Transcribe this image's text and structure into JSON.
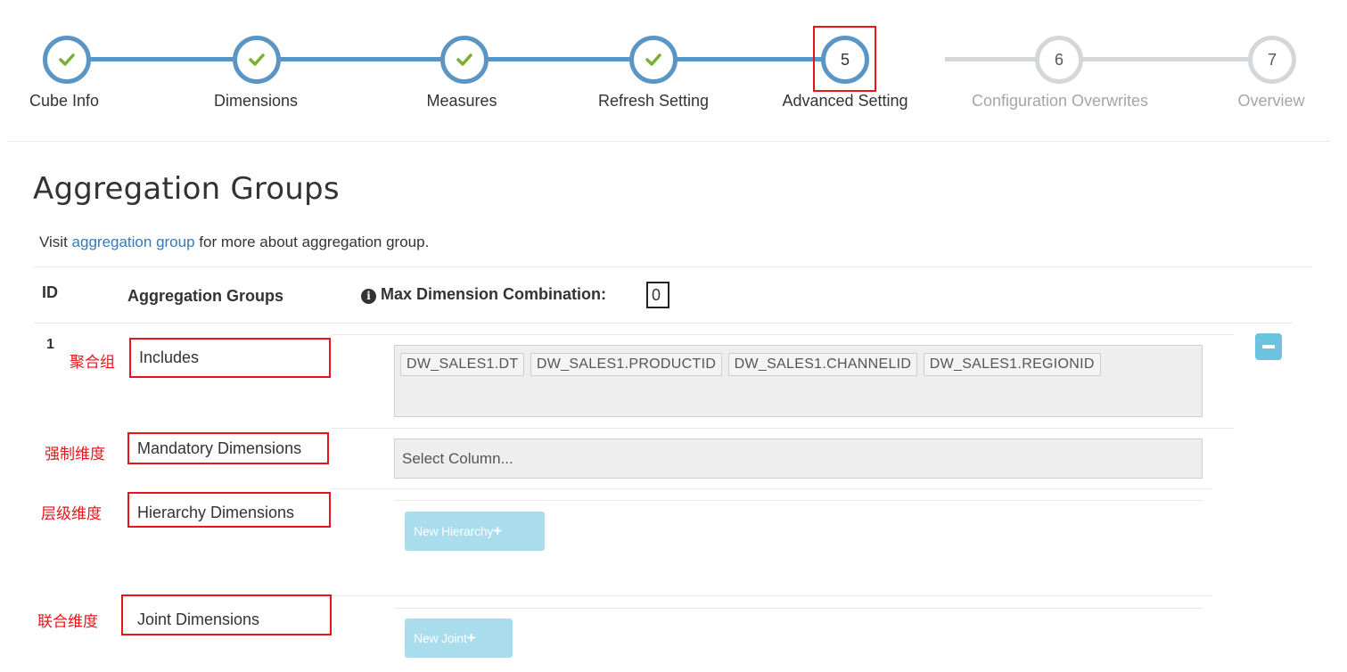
{
  "wizard": {
    "steps": [
      {
        "label": "Cube Info",
        "status": "done",
        "number": ""
      },
      {
        "label": "Dimensions",
        "status": "done",
        "number": ""
      },
      {
        "label": "Measures",
        "status": "done",
        "number": ""
      },
      {
        "label": "Refresh Setting",
        "status": "done",
        "number": ""
      },
      {
        "label": "Advanced Setting",
        "status": "current",
        "number": "5"
      },
      {
        "label": "Configuration Overwrites",
        "status": "todo",
        "number": "6"
      },
      {
        "label": "Overview",
        "status": "todo",
        "number": "7"
      }
    ],
    "colors": {
      "active": "#5b95c4",
      "inactive": "#d4d7da",
      "check": "#7ab030",
      "highlight": "#e8141b"
    }
  },
  "page": {
    "title": "Aggregation Groups",
    "visit_prefix": "Visit ",
    "visit_link": "aggregation group",
    "visit_suffix": " for more about aggregation group."
  },
  "table": {
    "headers": {
      "id": "ID",
      "groups": "Aggregation Groups",
      "max_combination": "Max Dimension Combination:"
    },
    "max_combination_value": "0",
    "group": {
      "id": "1",
      "includes": {
        "note": "聚合组",
        "label": "Includes",
        "tags": [
          "DW_SALES1.DT",
          "DW_SALES1.PRODUCTID",
          "DW_SALES1.CHANNELID",
          "DW_SALES1.REGIONID"
        ]
      },
      "mandatory": {
        "note": "强制维度",
        "label": "Mandatory Dimensions",
        "placeholder": "Select Column..."
      },
      "hierarchy": {
        "note": "层级维度",
        "label": "Hierarchy Dimensions",
        "button": "New Hierarchy"
      },
      "joint": {
        "note": "联合维度",
        "label": "Joint Dimensions",
        "button": "New Joint"
      }
    }
  }
}
